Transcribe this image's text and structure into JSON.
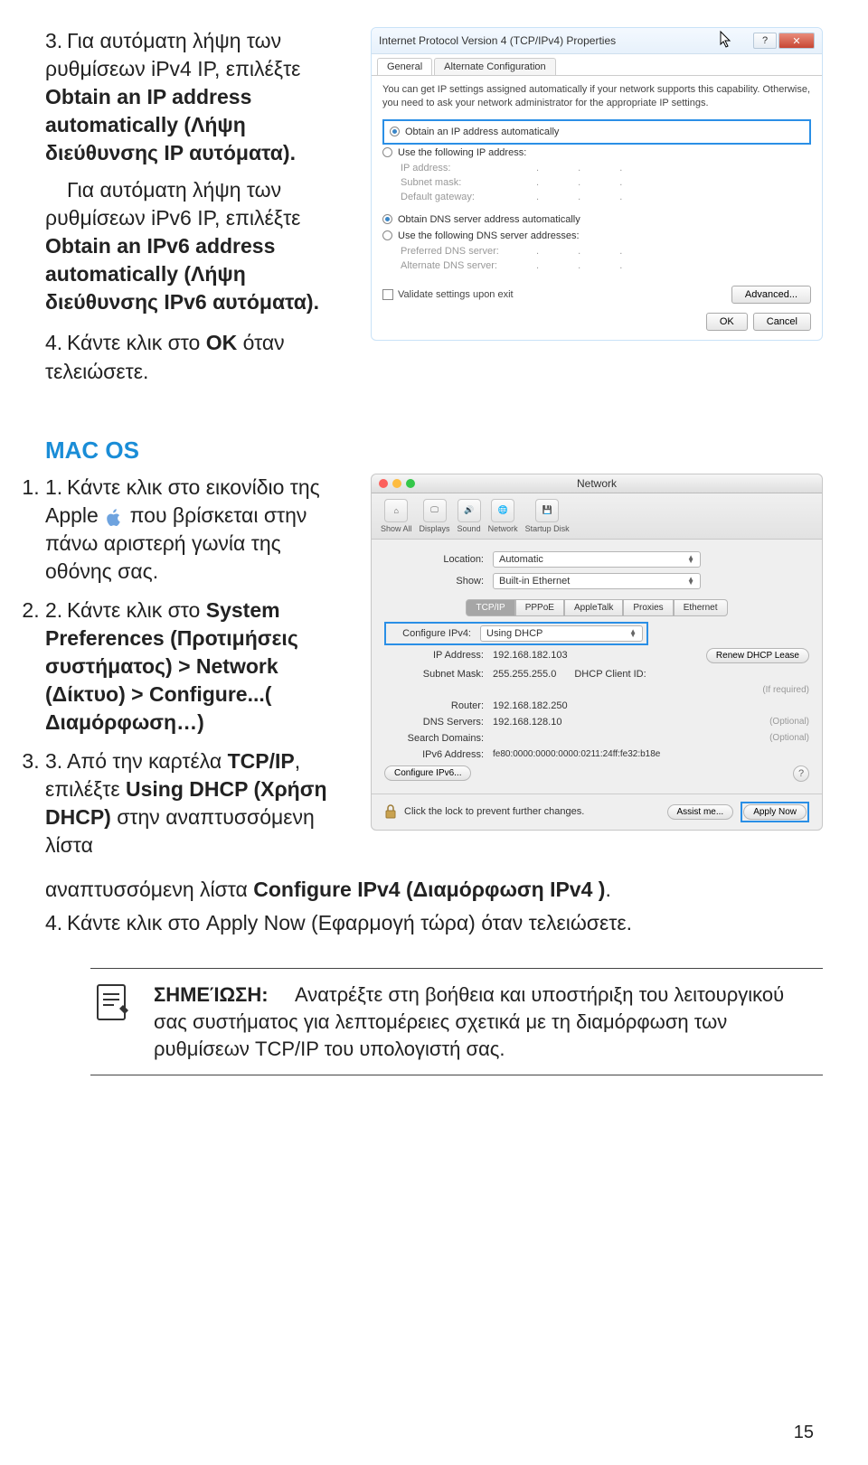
{
  "step3": {
    "num": "3.",
    "part1": "Για αυτόματη λήψη των ρυθμίσεων iPv4 IP, επιλέξτε ",
    "bold1": "Obtain an IP address automatically (Λήψη διεύθυνσης IP αυτόματα).",
    "part2": "Για αυτόματη λήψη των ρυθμίσεων iPv6 IP, επιλέξτε ",
    "bold2": "Obtain an IPv6 address automatically (Λήψη διεύθυνσης IPv6 αυτόματα)."
  },
  "step4": {
    "num": "4.",
    "part1": "Κάντε κλικ στο ",
    "bold": "OK",
    "part2": " όταν τελειώσετε."
  },
  "win": {
    "title": "Internet Protocol Version 4 (TCP/IPv4) Properties",
    "help": "?",
    "close": "✕",
    "tab_general": "General",
    "tab_alt": "Alternate Configuration",
    "info": "You can get IP settings assigned automatically if your network supports this capability. Otherwise, you need to ask your network administrator for the appropriate IP settings.",
    "r_auto_ip": "Obtain an IP address automatically",
    "r_use_ip": "Use the following IP address:",
    "lbl_ip": "IP address:",
    "lbl_mask": "Subnet mask:",
    "lbl_gw": "Default gateway:",
    "r_auto_dns": "Obtain DNS server address automatically",
    "r_use_dns": "Use the following DNS server addresses:",
    "lbl_pdns": "Preferred DNS server:",
    "lbl_adns": "Alternate DNS server:",
    "chk_validate": "Validate settings upon exit",
    "btn_adv": "Advanced...",
    "btn_ok": "OK",
    "btn_cancel": "Cancel",
    "dots": ".  .  ."
  },
  "macos_heading": "MAC OS",
  "mstep1": {
    "num": "1.",
    "p1": "Κάντε κλικ στο εικονίδιο της Apple ",
    "p2": " που βρίσκεται στην πάνω αριστερή γωνία της οθόνης σας."
  },
  "mstep2": {
    "num": "2.",
    "p1": "Κάντε κλικ στο ",
    "b1": "System Preferences (Προτιμήσεις συστήματος) > Network (Δίκτυο) > Configure...( Διαμόρφωση…)"
  },
  "mstep3": {
    "num": "3.",
    "p1": "Από την καρτέλα ",
    "b1": "TCP/IP",
    "p2": ", επιλέξτε ",
    "b2": "Using DHCP (Χρήση DHCP)",
    "p3": " στην αναπτυσσόμενη λίστα ",
    "b3": "Configure IPv4 (Διαμόρφωση IPv4 )",
    "p4": "."
  },
  "mstep4": {
    "num": "4.",
    "text": "Κάντε κλικ στο Apply Now (Εφαρμογή τώρα) όταν τελειώσετε."
  },
  "mac": {
    "title": "Network",
    "tb_showall": "Show All",
    "tb_displays": "Displays",
    "tb_sound": "Sound",
    "tb_network": "Network",
    "tb_startup": "Startup Disk",
    "lbl_location": "Location:",
    "val_location": "Automatic",
    "lbl_show": "Show:",
    "val_show": "Built-in Ethernet",
    "tab_tcpip": "TCP/IP",
    "tab_pppoe": "PPPoE",
    "tab_appletalk": "AppleTalk",
    "tab_proxies": "Proxies",
    "tab_ethernet": "Ethernet",
    "lbl_cfg4": "Configure IPv4:",
    "val_cfg4": "Using DHCP",
    "lbl_ip": "IP Address:",
    "val_ip": "192.168.182.103",
    "btn_renew": "Renew DHCP Lease",
    "lbl_mask": "Subnet Mask:",
    "val_mask": "255.255.255.0",
    "lbl_dhcpid": "DHCP Client ID:",
    "hint_req": "(If required)",
    "lbl_router": "Router:",
    "val_router": "192.168.182.250",
    "lbl_dns": "DNS Servers:",
    "val_dns": "192.168.128.10",
    "opt": "(Optional)",
    "lbl_search": "Search Domains:",
    "lbl_ipv6": "IPv6 Address:",
    "val_ipv6": "fe80:0000:0000:0000:0211:24ff:fe32:b18e",
    "btn_cfg6": "Configure IPv6...",
    "lock_text": "Click the lock to prevent further changes.",
    "btn_assist": "Assist me...",
    "btn_apply": "Apply Now",
    "help": "?"
  },
  "note": {
    "label": "ΣΗΜΕΊΩΣΗ:",
    "text": "Ανατρέξτε στη βοήθεια και υποστήριξη του λειτουργικού σας συστήματος για λεπτομέρειες σχετικά με τη διαμόρφωση των ρυθμίσεων TCP/IP του υπολογιστή σας."
  },
  "page_num": "15"
}
